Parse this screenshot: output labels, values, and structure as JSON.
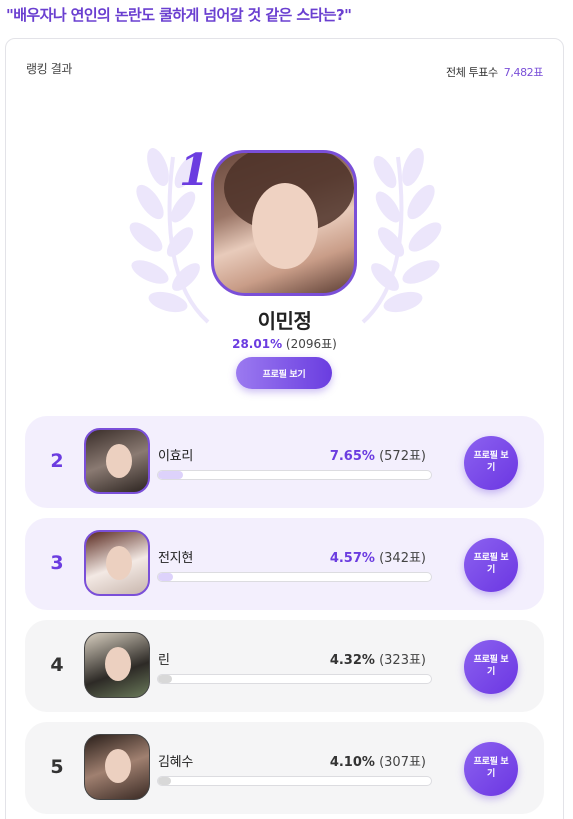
{
  "question": "\"배우자나 연인의 논란도 쿨하게 넘어갈 것 같은 스타는?\"",
  "card": {
    "label": "랭킹 결과",
    "total_label": "전체 투표수",
    "total_value": "7,482표"
  },
  "winner": {
    "rank": "1",
    "name": "이민정",
    "percent": "28.01%",
    "votes": "(2096표)",
    "button": "프로필 보기"
  },
  "rows": [
    {
      "rank": "2",
      "name": "이효리",
      "percent": "7.65%",
      "votes": "(572표)",
      "share": 0.0765,
      "button": "프로필 보기",
      "style": "purple"
    },
    {
      "rank": "3",
      "name": "전지현",
      "percent": "4.57%",
      "votes": "(342표)",
      "share": 0.0457,
      "button": "프로필 보기",
      "style": "purple"
    },
    {
      "rank": "4",
      "name": "린",
      "percent": "4.32%",
      "votes": "(323표)",
      "share": 0.0432,
      "button": "프로필 보기",
      "style": "gray"
    },
    {
      "rank": "5",
      "name": "김혜수",
      "percent": "4.10%",
      "votes": "(307표)",
      "share": 0.041,
      "button": "프로필 보기",
      "style": "gray"
    }
  ],
  "colors": {
    "accent": "#6b3ce0",
    "row_highlight": "#f3effd",
    "row_normal": "#f5f5f6"
  }
}
